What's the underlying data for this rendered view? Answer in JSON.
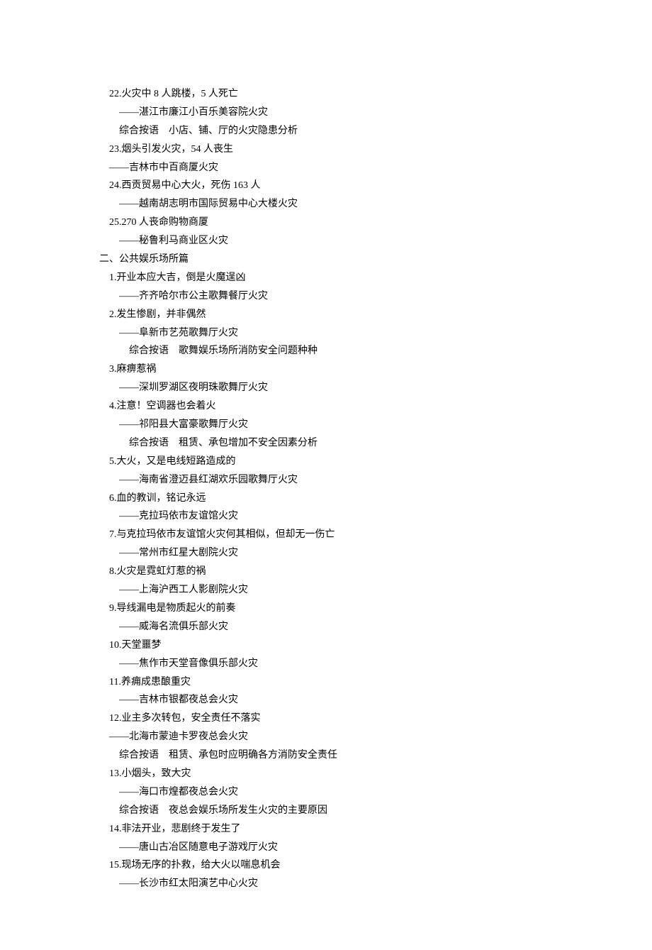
{
  "lines": [
    "　22.火灾中 8 人跳楼，5 人死亡",
    "　　——湛江市廉江小百乐美容院火灾",
    "　　综合按语　小店、铺、厅的火灾隐患分析",
    "　23.烟头引发火灾，54 人丧生",
    "　——吉林市中百商厦火灾",
    "　24.西贡贸易中心大火，死伤 163 人",
    "　　——越南胡志明市国际贸易中心大楼火灾",
    "　25.270 人丧命购物商厦",
    "　　——秘鲁利马商业区火灾",
    "二、公共娱乐场所篇",
    "　1.开业本应大吉，倒是火魔逞凶",
    "　　——齐齐哈尔市公主歌舞餐厅火灾",
    "　2.发生惨剧，并非偶然",
    "　　——阜新市艺苑歌舞厅火灾",
    "　　　综合按语　歌舞娱乐场所消防安全问题种种",
    "　3.麻痹惹祸",
    "　　——深圳罗湖区夜明珠歌舞厅火灾",
    "　4.注意！空调器也会着火",
    "　　——祁阳县大富豪歌舞厅火灾",
    "　　　综合按语　租赁、承包增加不安全因素分析",
    "　5.大火，又是电线短路造成的",
    "　　——海南省澄迈县红湖欢乐园歌舞厅火灾",
    "　6.血的教训，铭记永远",
    "　　——克拉玛依市友谊馆火灾",
    "　7.与克拉玛依市友谊馆火灾何其相似，但却无一伤亡",
    "　　——常州市红星大剧院火灾",
    "　8.火灾是霓虹灯惹的祸",
    "　　——上海沪西工人影剧院火灾",
    "　9.导线漏电是物质起火的前奏",
    "　　——威海名流俱乐部火灾",
    "　10.天堂噩梦",
    "　　——焦作市天堂音像俱乐部火灾",
    "　11.养痈成患酿重灾",
    "　　——吉林市银都夜总会火灾",
    "　12.业主多次转包，安全责任不落实",
    "　——北海市蒙迪卡罗夜总会火灾",
    "　　综合按语　租赁、承包时应明确各方消防安全责任",
    "　13.小烟头，致大灾",
    "　　——海口市煌都夜总会火灾",
    "　　综合按语　夜总会娱乐场所发生火灾的主要原因",
    "　14.非法开业，悲剧终于发生了",
    "　　——唐山古冶区随意电子游戏厅火灾",
    "　15.现场无序的扑救，给大火以喘息机会",
    "　　——长沙市红太阳演艺中心火灾"
  ]
}
